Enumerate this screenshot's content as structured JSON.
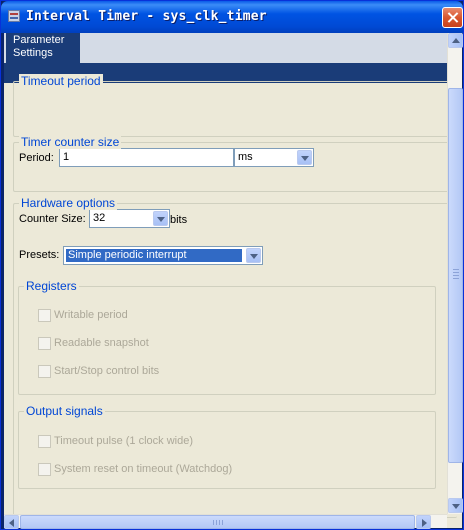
{
  "window": {
    "title": "Interval Timer - sys_clk_timer"
  },
  "tabs": [
    {
      "label_line1": "Parameter",
      "label_line2": "Settings"
    }
  ],
  "timeout_period": {
    "legend": "Timeout period",
    "period_label": "Period:",
    "period_value": "1",
    "unit_value": "ms"
  },
  "counter_size": {
    "legend": "Timer counter size",
    "label": "Counter Size:",
    "value": "32",
    "unit": "bits"
  },
  "hardware_options": {
    "legend": "Hardware options",
    "presets_label": "Presets:",
    "presets_value": "Simple periodic interrupt",
    "registers": {
      "legend": "Registers",
      "items": [
        {
          "label": "Writable period",
          "checked": false,
          "enabled": false
        },
        {
          "label": "Readable snapshot",
          "checked": false,
          "enabled": false
        },
        {
          "label": "Start/Stop control bits",
          "checked": false,
          "enabled": false
        }
      ]
    },
    "output_signals": {
      "legend": "Output signals",
      "items": [
        {
          "label": "Timeout pulse (1 clock wide)",
          "checked": false,
          "enabled": false
        },
        {
          "label": "System reset on timeout (Watchdog)",
          "checked": false,
          "enabled": false
        }
      ]
    }
  },
  "colors": {
    "title_bar": "#0054e3",
    "tab_active": "#1a3c78",
    "legend_text": "#0046d5",
    "selection": "#316ac5",
    "disabled_text": "#aca899"
  },
  "icons": [
    "window-icon",
    "close-icon",
    "scroll-up-icon",
    "scroll-down-icon",
    "scroll-left-icon",
    "scroll-right-icon"
  ]
}
